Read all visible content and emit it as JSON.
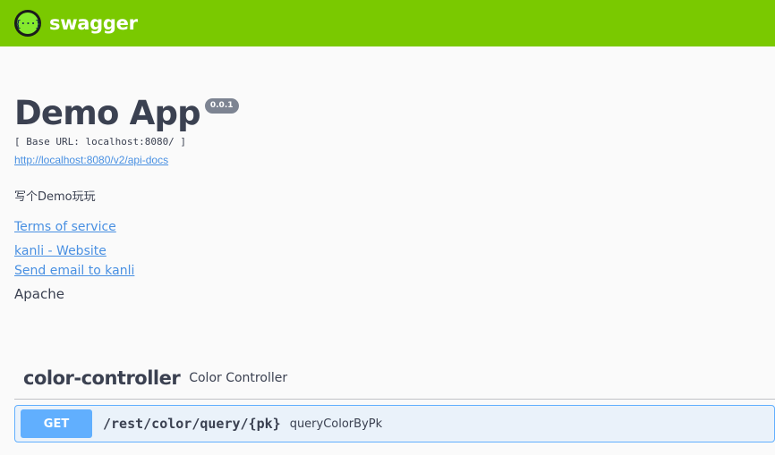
{
  "topbar": {
    "brand_name": "swagger",
    "logo_glyph": "{···}",
    "color": "#7ac900"
  },
  "info": {
    "title": "Demo App",
    "version": "0.0.1",
    "base_url": "[ Base URL: localhost:8080/ ]",
    "api_docs_link": "http://localhost:8080/v2/api-docs",
    "description": "写个Demo玩玩",
    "terms_of_service": "Terms of service",
    "contact_website": "kanli - Website",
    "contact_email": "Send email to kanli",
    "license": "Apache"
  },
  "tags": [
    {
      "name": "color-controller",
      "description": "Color Controller",
      "operations": [
        {
          "method": "GET",
          "path": "/rest/color/query/{pk}",
          "summary": "queryColorByPk",
          "method_color": "#61affe"
        }
      ]
    }
  ]
}
